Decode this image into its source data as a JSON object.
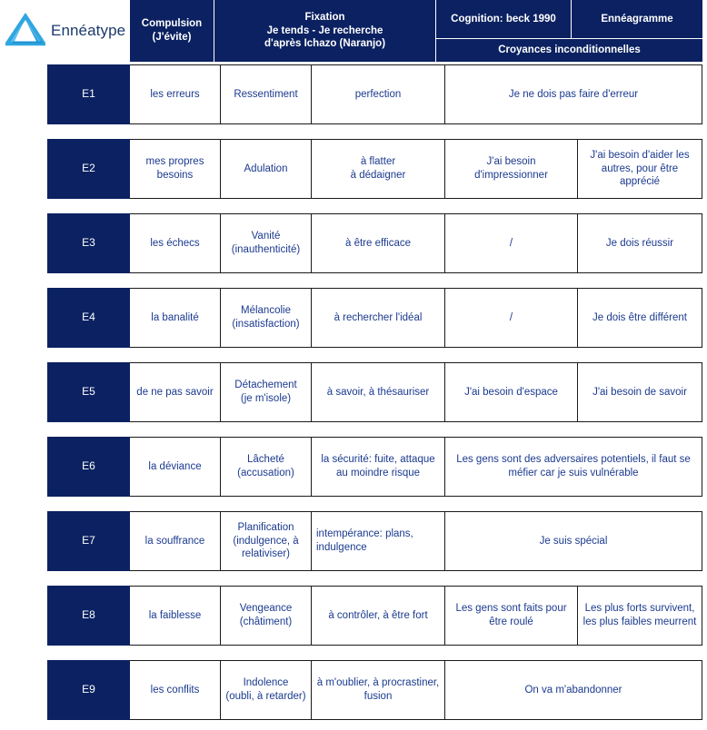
{
  "brand": {
    "name": "Ennéatype",
    "logo_icon": "triangle-logo-icon",
    "logo_color": "#30a6e0"
  },
  "colors": {
    "header_bg": "#0b2161",
    "header_text": "#ffffff",
    "cell_text": "#1b3a8f",
    "cell_bg": "#ffffff",
    "border": "#1a1a1a",
    "brand_text": "#1b3a6b",
    "logo_blue": "#30a6e0"
  },
  "header": {
    "compulsion": {
      "line1": "Compulsion",
      "line2": "(J'évite)"
    },
    "fixation": {
      "line1": "Fixation",
      "line2": "Je tends  - Je recherche",
      "line3": "d'après Ichazo (Naranjo)"
    },
    "cognition": "Cognition: beck 1990",
    "enneagramme": "Ennéagramme",
    "croyances": "Croyances inconditionnelles"
  },
  "rows": [
    {
      "etype": "E1",
      "compulsion": "les erreurs",
      "je_tends": "Ressentiment",
      "je_recherche": "perfection",
      "merged": true,
      "merged_text": "Je ne dois pas faire d'erreur",
      "cognition": "",
      "enneagramme": "",
      "align_je_recherche": "center"
    },
    {
      "etype": "E2",
      "compulsion": "mes propres besoins",
      "je_tends": "Adulation",
      "je_recherche": "à flatter\nà dédaigner",
      "merged": false,
      "merged_text": "",
      "cognition": "J'ai besoin d'impressionner",
      "enneagramme": "J'ai besoin d'aider les autres, pour être apprécié",
      "align_je_recherche": "center"
    },
    {
      "etype": "E3",
      "compulsion": "les échecs",
      "je_tends": "Vanité\n(inauthenticité)",
      "je_recherche": "à être efficace",
      "merged": false,
      "merged_text": "",
      "cognition": "/",
      "enneagramme": "Je dois réussir",
      "align_je_recherche": "center"
    },
    {
      "etype": "E4",
      "compulsion": "la banalité",
      "je_tends": "Mélancolie\n(insatisfaction)",
      "je_recherche": "à rechercher l'idéal",
      "merged": false,
      "merged_text": "",
      "cognition": "/",
      "enneagramme": "Je dois être différent",
      "align_je_recherche": "center"
    },
    {
      "etype": "E5",
      "compulsion": "de ne pas savoir",
      "je_tends": "Détachement\n(je m'isole)",
      "je_recherche": "à savoir, à thésauriser",
      "merged": false,
      "merged_text": "",
      "cognition": "J'ai besoin d'espace",
      "enneagramme": "J'ai besoin de savoir",
      "align_je_recherche": "center"
    },
    {
      "etype": "E6",
      "compulsion": "la déviance",
      "je_tends": "Lâcheté\n(accusation)",
      "je_recherche": "la sécurité: fuite, attaque au moindre risque",
      "merged": true,
      "merged_text": "Les gens sont des adversaires potentiels, il faut se méfier car je suis vulnérable",
      "cognition": "",
      "enneagramme": "",
      "align_je_recherche": "center"
    },
    {
      "etype": "E7",
      "compulsion": "la souffrance",
      "je_tends": "Planification\n(indulgence, à relativiser)",
      "je_recherche": "intempérance: plans, indulgence",
      "merged": true,
      "merged_text": "Je suis spécial",
      "cognition": "",
      "enneagramme": "",
      "align_je_recherche": "left"
    },
    {
      "etype": "E8",
      "compulsion": "la faiblesse",
      "je_tends": "Vengeance\n(châtiment)",
      "je_recherche": "à contrôler, à être fort",
      "merged": false,
      "merged_text": "",
      "cognition": "Les gens sont faits pour être roulé",
      "enneagramme": "Les plus forts survivent, les plus faibles meurrent",
      "align_je_recherche": "center"
    },
    {
      "etype": "E9",
      "compulsion": "les conflits",
      "je_tends": "Indolence\n(oubli, à retarder)",
      "je_recherche": "à m'oublier, à procrastiner, fusion",
      "merged": true,
      "merged_text": "On va m'abandonner",
      "cognition": "",
      "enneagramme": "",
      "align_je_recherche": "center"
    }
  ]
}
